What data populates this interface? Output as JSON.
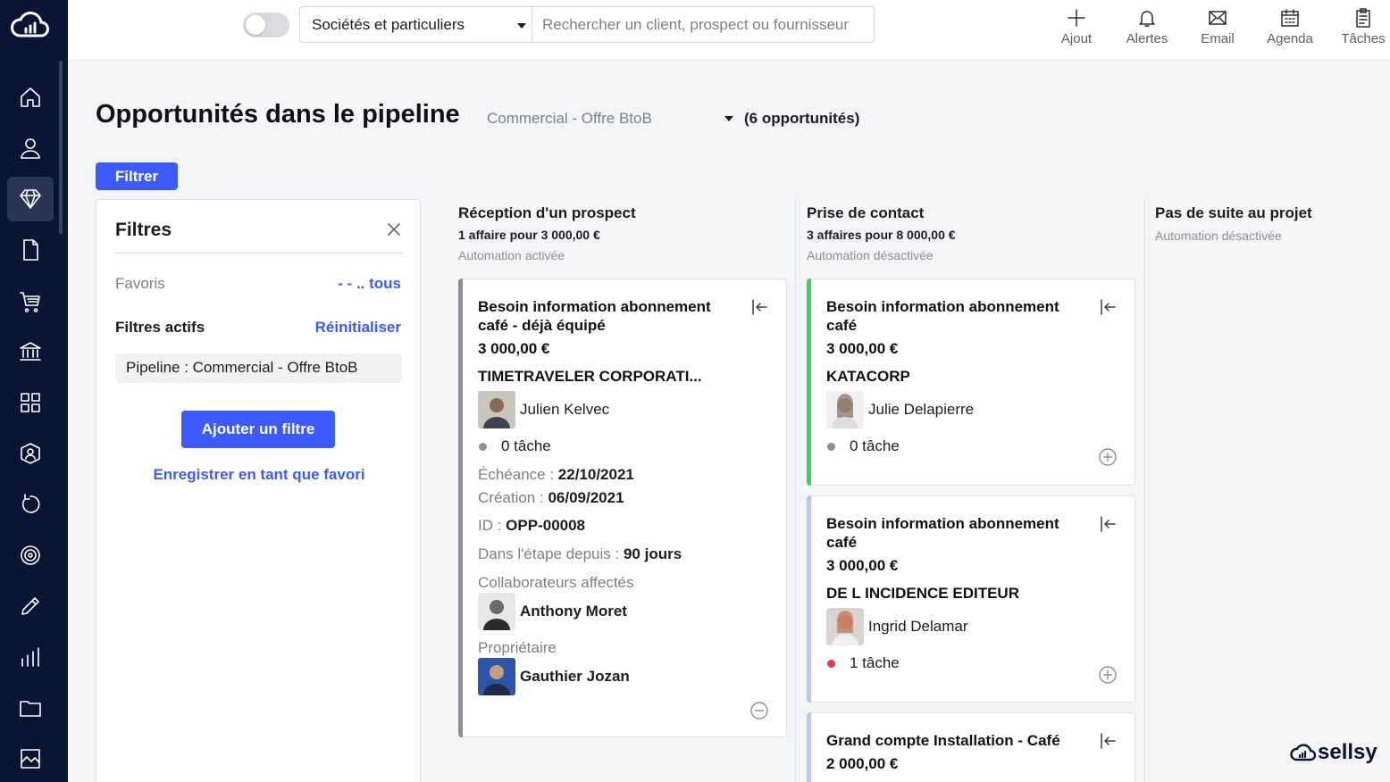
{
  "topbar": {
    "scope_select": "Sociétés et particuliers",
    "search_placeholder": "Rechercher un client, prospect ou fournisseur",
    "actions": [
      {
        "label": "Ajout",
        "icon": "plus-icon"
      },
      {
        "label": "Alertes",
        "icon": "bell-icon"
      },
      {
        "label": "Email",
        "icon": "mail-icon"
      },
      {
        "label": "Agenda",
        "icon": "calendar-icon"
      },
      {
        "label": "Tâches",
        "icon": "clipboard-icon"
      }
    ]
  },
  "sidebar": {
    "items": [
      "home-icon",
      "user-icon",
      "diamond-icon",
      "document-icon",
      "cart-icon",
      "bank-icon",
      "grid-icon",
      "support-icon",
      "refresh-icon",
      "target-icon",
      "pencil-icon",
      "chart-icon",
      "folder-icon",
      "image-icon"
    ],
    "active": "diamond-icon"
  },
  "header": {
    "title": "Opportunités dans le pipeline",
    "pipeline": "Commercial - Offre BtoB",
    "count": "(6 opportunités)",
    "filter_button": "Filtrer"
  },
  "filters": {
    "title": "Filtres",
    "favorites_label": "Favoris",
    "favorites_all": "- - .. tous",
    "active_label": "Filtres actifs",
    "reset_label": "Réinitialiser",
    "chip": "Pipeline : Commercial - Offre BtoB",
    "add_button": "Ajouter un filtre",
    "save_link": "Enregistrer en tant que favori"
  },
  "columns": [
    {
      "name": "Réception d'un prospect",
      "summary": "1 affaire pour 3 000,00 €",
      "automation": "Automation activée"
    },
    {
      "name": "Prise de contact",
      "summary": "3 affaires pour 8 000,00 €",
      "automation": "Automation désactivée"
    },
    {
      "name": "Pas de suite au projet",
      "automation": "Automation désactivée"
    }
  ],
  "cards": {
    "c1": {
      "title": "Besoin information abonnement café - déjà équipé",
      "amount": "3 000,00 €",
      "company": "TIMETRAVELER CORPORATI...",
      "contact": "Julien Kelvec",
      "tasks": "0 tâche",
      "due_label": "Échéance",
      "due_value": "22/10/2021",
      "created_label": "Création",
      "created_value": "06/09/2021",
      "id_label": "ID",
      "id_value": "OPP-00008",
      "stage_label": "Dans l'étape depuis",
      "stage_value": "90 jours",
      "collab_label": "Collaborateurs affectés",
      "collab_name": "Anthony Moret",
      "owner_label": "Propriétaire",
      "owner_name": "Gauthier Jozan",
      "accent": "#8b8f98"
    },
    "c2": {
      "title": "Besoin information abonnement café",
      "amount": "3 000,00 €",
      "company": "KATACORP",
      "contact": "Julie Delapierre",
      "tasks": "0 tâche",
      "accent": "#3ecf6e"
    },
    "c3": {
      "title": "Besoin information abonnement café",
      "amount": "3 000,00 €",
      "company": "DE L INCIDENCE EDITEUR",
      "contact": "Ingrid Delamar",
      "tasks": "1 tâche",
      "accent": "#b8c6f5"
    },
    "c4": {
      "title": "Grand compte Installation - Café",
      "amount": "2 000,00 €",
      "accent": "#b8c6f5"
    }
  },
  "brand": "sellsy",
  "colors": {
    "primary": "#3d5afe",
    "sidebar": "#0a1433",
    "task_none": "#8b8f98",
    "task_alert": "#e53950"
  }
}
